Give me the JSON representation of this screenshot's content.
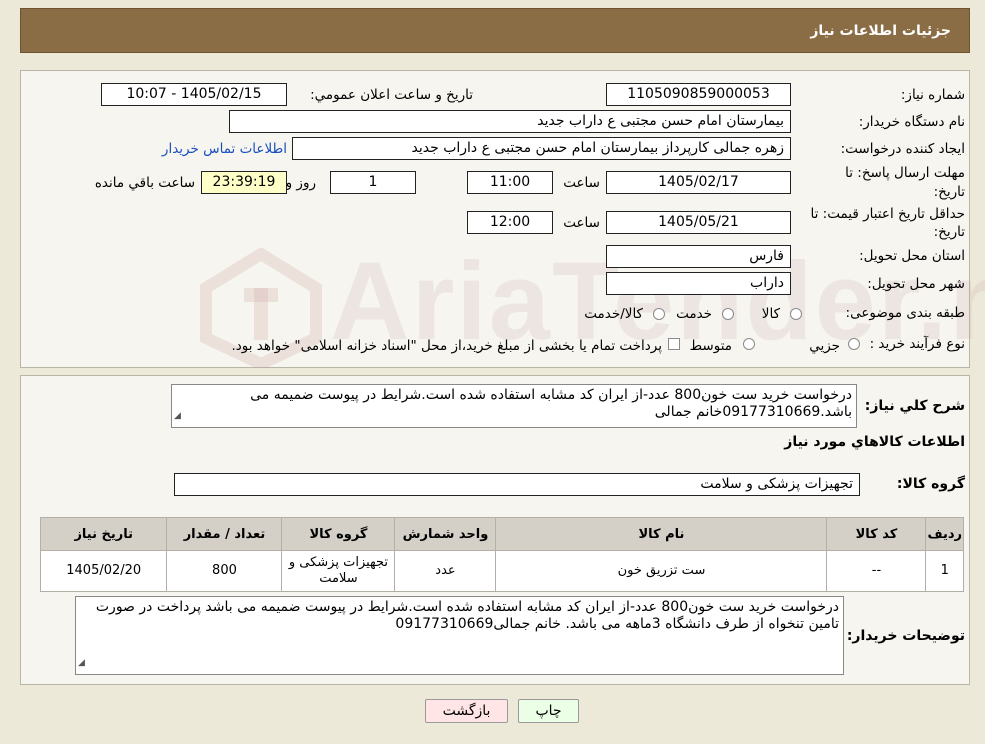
{
  "header": {
    "title": "جزئیات اطلاعات نیاز"
  },
  "watermark": "AriaTender.neT",
  "form": {
    "need_number_label": "شماره نیاز:",
    "need_number": "1105090859000053",
    "announce_label": "تاریخ و ساعت اعلان عمومي:",
    "announce_value": "1405/02/15 - 10:07",
    "buyer_org_label": "نام دستگاه خریدار:",
    "buyer_org": "بیمارستان امام حسن مجتبی  ع  داراب جدید",
    "creator_label": "ایجاد کننده درخواست:",
    "creator": "زهره جمالی کارپرداز بیمارستان امام حسن مجتبی  ع  داراب جدید",
    "contact_link": "اطلاعات تماس خریدار",
    "deadline_label_1": "مهلت ارسال پاسخ: تا",
    "deadline_label_2": "تاریخ:",
    "deadline_date": "1405/02/17",
    "time_label": "ساعت",
    "deadline_time": "11:00",
    "days_value": "1",
    "days_label": "روز و",
    "remaining_time": "23:39:19",
    "remaining_label": "ساعت باقي مانده",
    "validity_label_1": "حداقل تاریخ اعتبار قیمت: تا",
    "validity_label_2": "تاریخ:",
    "validity_date": "1405/05/21",
    "validity_time": "12:00",
    "province_label": "استان محل تحویل:",
    "province": "فارس",
    "city_label": "شهر محل تحویل:",
    "city": "داراب",
    "category_label": "طبقه بندی موضوعی:",
    "category_options": [
      "کالا",
      "خدمت",
      "کالا/خدمت"
    ],
    "process_label": "نوع فرآیند خرید :",
    "process_options": [
      "جزیي",
      "متوسط"
    ],
    "process_note": "پرداخت تمام یا بخشی از مبلغ خرید،از محل \"اسناد خزانه اسلامی\" خواهد بود."
  },
  "description": {
    "label": "شرح کلي نیاز:",
    "text": "درخواست خرید ست خون800 عدد-از ایران کد مشابه استفاده شده است.شرایط در پیوست ضمیمه می باشد.09177310669خانم جمالی"
  },
  "goods": {
    "section_title": "اطلاعات کالاهاي مورد نیاز",
    "group_label": "گروه کالا:",
    "group_value": "تجهیزات پزشکی و سلامت",
    "columns": [
      "ردیف",
      "کد کالا",
      "نام کالا",
      "واحد شمارش",
      "گروه کالا",
      "تعداد / مقدار",
      "تاریخ نیاز"
    ],
    "rows": [
      [
        "1",
        "--",
        "ست تزریق خون",
        "عدد",
        "تجهیزات پزشکی و سلامت",
        "800",
        "1405/02/20"
      ]
    ]
  },
  "buyer_notes": {
    "label": "توضیحات خریدار:",
    "text": "درخواست خرید ست خون800 عدد-از ایران کد مشابه استفاده شده است.شرایط در پیوست ضمیمه می باشد پرداخت در صورت تامین تنخواه از طرف دانشگاه 3ماهه می باشد. خانم جمالی09177310669"
  },
  "buttons": {
    "print": "چاپ",
    "back": "بازگشت"
  },
  "colors": {
    "header": "#8b6d45",
    "background": "#ece9d8",
    "link": "#1a4fbf"
  }
}
